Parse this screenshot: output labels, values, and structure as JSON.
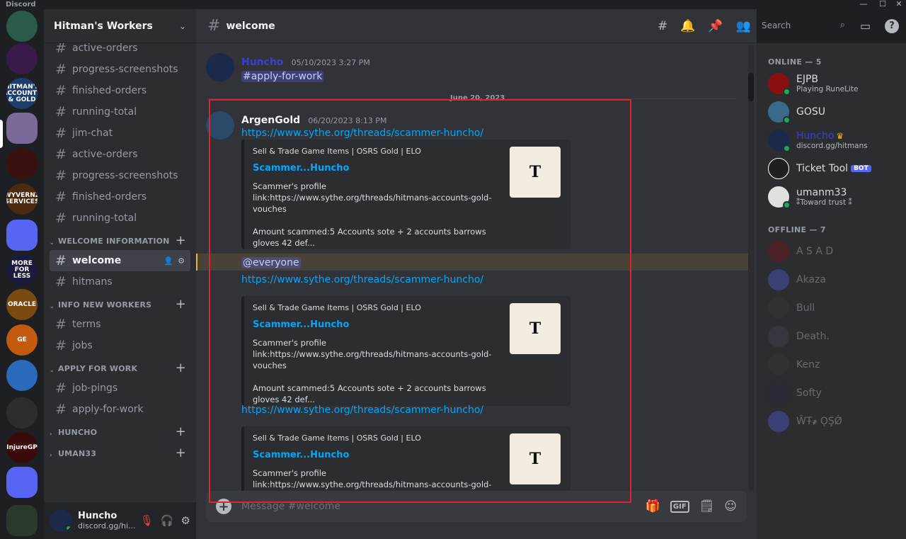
{
  "window": {
    "app_title": "Discord",
    "minimize": "—",
    "maximize": "☐",
    "close": "✕"
  },
  "rail": {
    "servers": [
      {
        "label": "",
        "color": "#2a5a4a"
      },
      {
        "label": "",
        "color": "#3a1a4a"
      },
      {
        "label": "HITMAN'S ACCOUNTS & GOLD",
        "color": "#1d3d6d"
      },
      {
        "label": "",
        "color": "#7a6a9a"
      },
      {
        "label": "",
        "color": "#3a1010"
      },
      {
        "label": "WYVERNZ SERVICES",
        "color": "#4a2a10"
      },
      {
        "label": "",
        "color": "#5865f2"
      },
      {
        "label": "MORE FOR LESS",
        "color": "#1a1a3a"
      },
      {
        "label": "ORACLE",
        "color": "#7a4a10"
      },
      {
        "label": "GE",
        "color": "#c25a10"
      },
      {
        "label": "",
        "color": "#2a6aba"
      },
      {
        "label": "",
        "color": "#2b2d31"
      },
      {
        "label": "InjureGP",
        "color": "#3a0a0a"
      },
      {
        "label": "",
        "color": "#5865f2"
      },
      {
        "label": "",
        "color": "#2a3a2a"
      }
    ]
  },
  "sidebar": {
    "guild_name": "Hitman's Workers",
    "top_channels": [
      "active-orders",
      "progress-screenshots",
      "finished-orders",
      "running-total",
      "jim-chat",
      "active-orders",
      "progress-screenshots",
      "finished-orders",
      "running-total"
    ],
    "categories": [
      {
        "name": "WELCOME INFORMATION",
        "channels": [
          "welcome",
          "hitmans"
        ]
      },
      {
        "name": "INFO NEW WORKERS",
        "channels": [
          "terms",
          "jobs"
        ]
      },
      {
        "name": "APPLY FOR WORK",
        "channels": [
          "job-pings",
          "apply-for-work"
        ]
      },
      {
        "name": "HUNCHO",
        "channels": []
      },
      {
        "name": "UMAN33",
        "channels": []
      }
    ],
    "user": {
      "name": "Huncho",
      "status": "discord.gg/hi..."
    }
  },
  "chat": {
    "channel": "welcome",
    "search_placeholder": "Search",
    "composer_placeholder": "Message #welcome",
    "gif_label": "GIF",
    "date_divider": "June 20, 2023",
    "msg1": {
      "author": "Huncho",
      "author_color": "#3b3fd8",
      "timestamp": "05/10/2023 3:27 PM",
      "mention": "#apply-for-work"
    },
    "msg2": {
      "author": "ArgenGold",
      "timestamp": "06/20/2023 8:13 PM",
      "link": "https://www.sythe.org/threads/scammer-huncho/",
      "mention": "@everyone",
      "embed": {
        "provider": "Sell & Trade Game Items | OSRS Gold | ELO",
        "title": "Scammer...Huncho",
        "desc1": "Scammer's profile link:https://www.sythe.org/threads/hitmans-accounts-gold-vouches",
        "desc2": "Amount scammed:5 Accounts sote + 2 accounts barrows gloves 42 def...",
        "thumb_letter": "T"
      }
    }
  },
  "members": {
    "online_label": "ONLINE — 5",
    "offline_label": "OFFLINE — 7",
    "online": [
      {
        "name": "EJPB",
        "status": "Playing RuneLite",
        "color": "#8a1010",
        "bot": false,
        "crown": false
      },
      {
        "name": "GOSU",
        "status": "",
        "color": "#3a6a8a",
        "bot": false,
        "crown": false
      },
      {
        "name": "Huncho",
        "status": "discord.gg/hitmans",
        "color": "#1b2a4a",
        "bot": false,
        "crown": true,
        "name_color": "#3b3fd8"
      },
      {
        "name": "Ticket Tool",
        "status": "",
        "color": "#1e1f22",
        "bot": true,
        "bot_label": "BOT",
        "crown": false
      },
      {
        "name": "umanm33",
        "status": "⁑Toward trust ⁑",
        "color": "#e0e0e0",
        "bot": false,
        "crown": false
      }
    ],
    "offline": [
      {
        "name": "A S A D",
        "color": "#8a1010"
      },
      {
        "name": "Akaza",
        "color": "#5865f2"
      },
      {
        "name": "Bull",
        "color": "#3a3a3a"
      },
      {
        "name": "Death.",
        "color": "#4a4a5a"
      },
      {
        "name": "Kenz",
        "color": "#3a3a3a"
      },
      {
        "name": "Softy",
        "color": "#2a2a3a"
      },
      {
        "name": "ŴŦ҂ ǪŞǾ",
        "color": "#5865f2"
      }
    ]
  }
}
